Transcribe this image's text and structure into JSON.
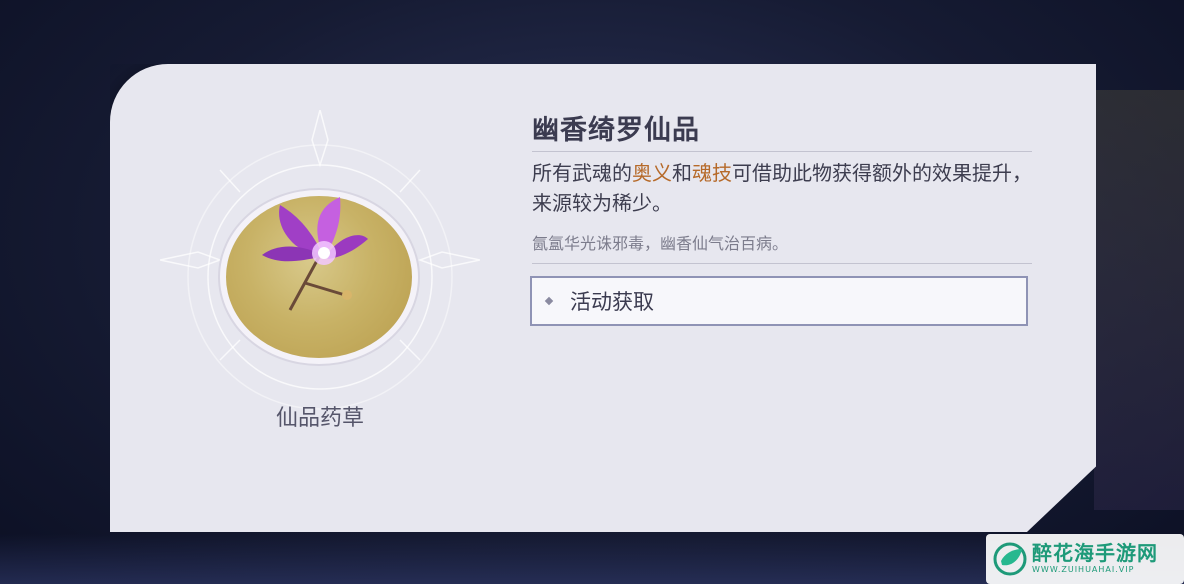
{
  "item": {
    "name": "幽香绮罗仙品",
    "type": "仙品药草",
    "description": {
      "part1": "所有武魂的",
      "highlight1": "奥义",
      "part2": "和",
      "highlight2": "魂技",
      "part3": "可借助此物获得额外的效果提升，来源较为稀少。"
    },
    "flavor": "氤氲华光诛邪毒，幽香仙气治百病。",
    "source": "活动获取"
  },
  "icons": {
    "item": "purple-flower-icon",
    "bullet": "diamond-icon",
    "watermark": "leaf-logo-icon"
  },
  "colors": {
    "panel": "#e7e7ef",
    "highlight": "#b66a2a",
    "coin": "#c8b266",
    "flower": "#b14ad1"
  },
  "watermark": {
    "cn": "醉花海手游网",
    "en": "WWW.ZUIHUAHAI.VIP"
  }
}
